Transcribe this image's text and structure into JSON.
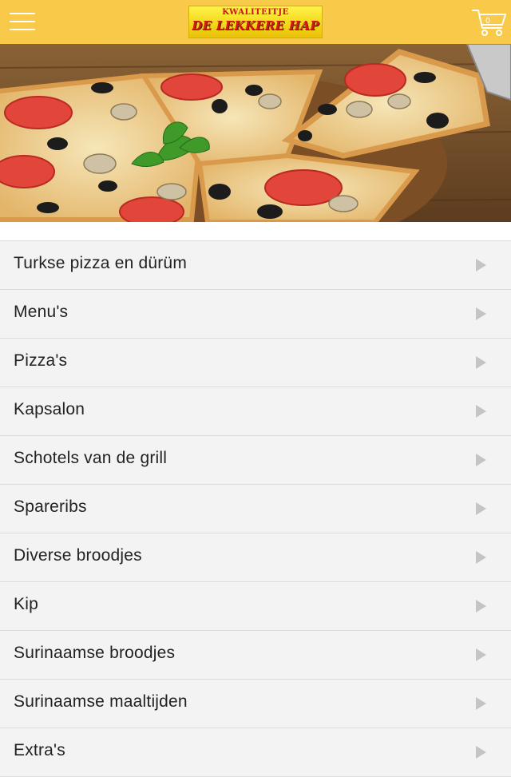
{
  "header": {
    "background": "#f9c94a",
    "menu_icon": "hamburger-menu-icon",
    "logo": {
      "line1": "KWALITEITJE",
      "line2": "DE LEKKERE HAP"
    },
    "cart": {
      "icon": "shopping-cart-icon",
      "count": "0"
    }
  },
  "hero": {
    "image": "pizza-photo"
  },
  "menu": {
    "items": [
      {
        "label": "Turkse pizza en dürüm"
      },
      {
        "label": "Menu's"
      },
      {
        "label": "Pizza's"
      },
      {
        "label": "Kapsalon"
      },
      {
        "label": "Schotels van de grill"
      },
      {
        "label": "Spareribs"
      },
      {
        "label": "Diverse broodjes"
      },
      {
        "label": "Kip"
      },
      {
        "label": "Surinaamse broodjes"
      },
      {
        "label": "Surinaamse maaltijden"
      },
      {
        "label": "Extra's"
      }
    ],
    "arrow_icon": "chevron-right-icon"
  }
}
